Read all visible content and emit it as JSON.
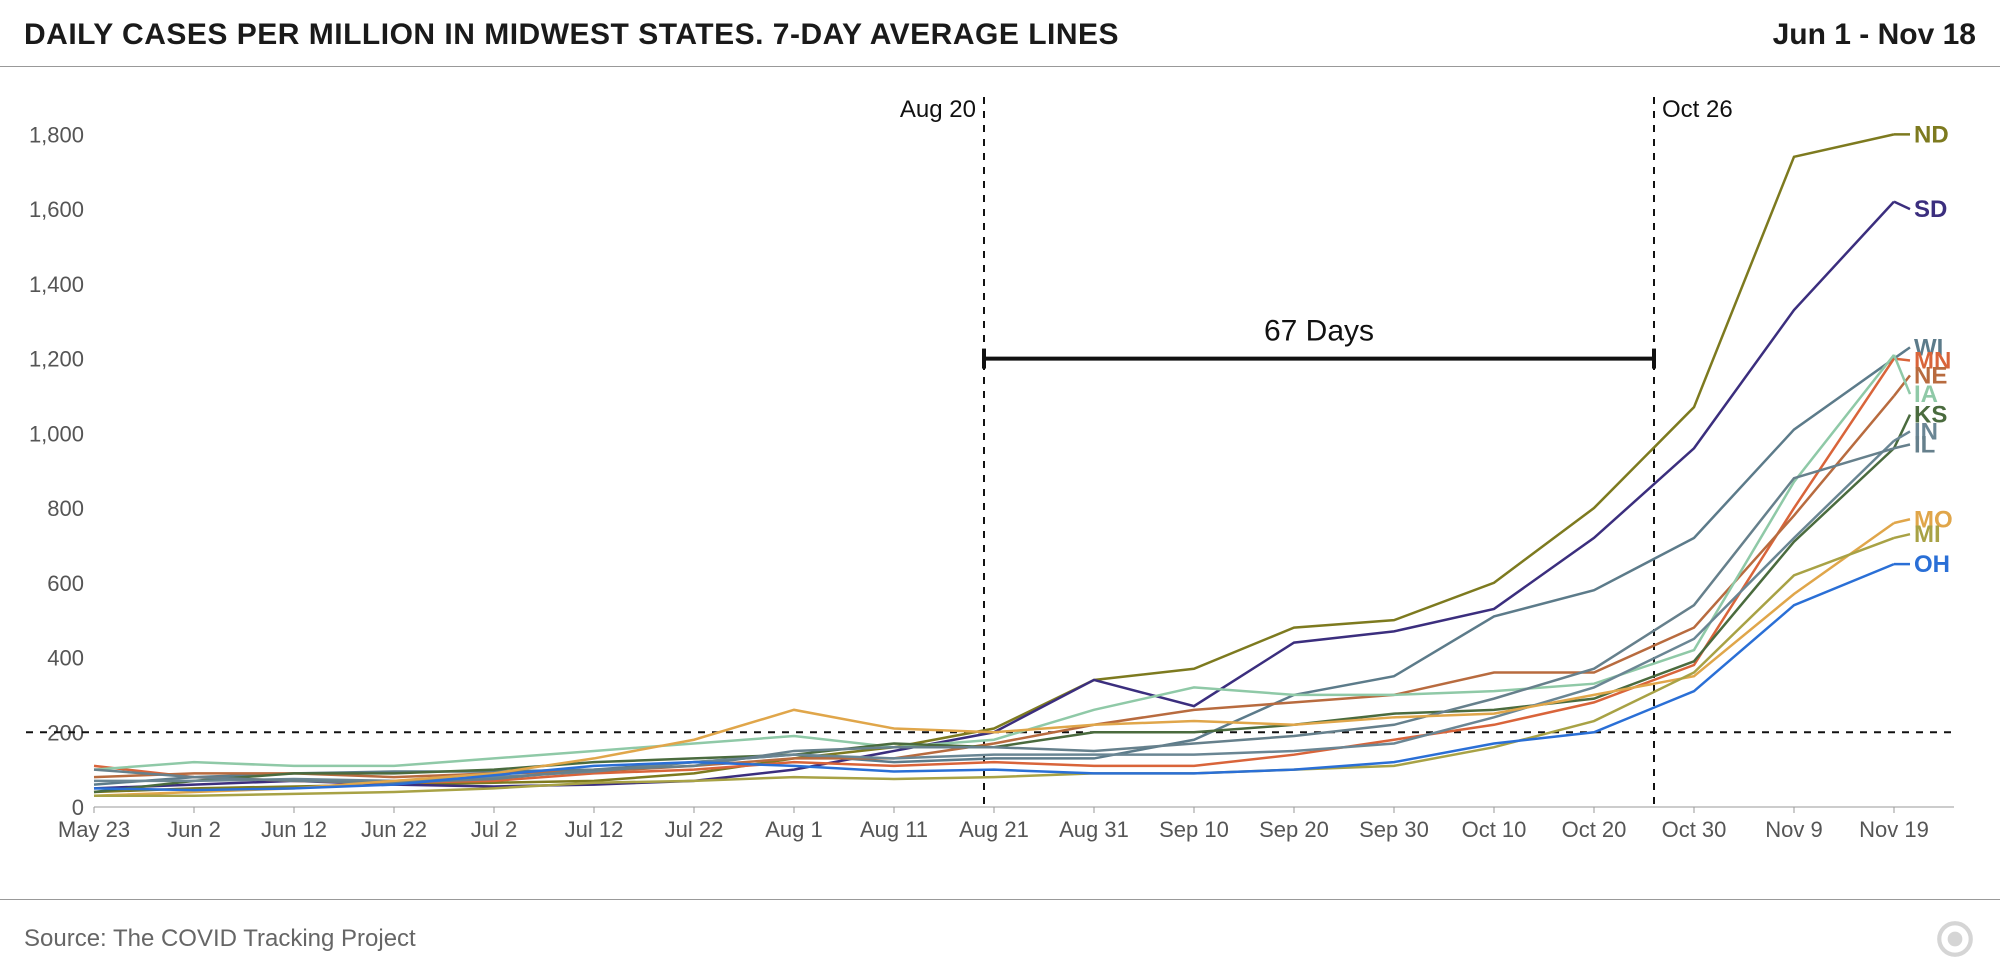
{
  "title": "DAILY CASES PER MILLION IN MIDWEST STATES. 7-DAY AVERAGE LINES",
  "date_range": "Jun 1 - Nov 18",
  "source": "Source: The COVID Tracking Project",
  "annotations": {
    "vline1_label": "Aug 20",
    "vline2_label": "Oct 26",
    "bracket_label": "67 Days",
    "hline_value": 200,
    "vline1_x": 89,
    "vline2_x": 156
  },
  "chart_data": {
    "type": "line",
    "title": "Daily cases per million in Midwest states. 7-day average lines",
    "xlabel": "",
    "ylabel": "",
    "ylim": [
      0,
      1900
    ],
    "x_categories": [
      "May 23",
      "Jun 2",
      "Jun 12",
      "Jun 22",
      "Jul 2",
      "Jul 12",
      "Jul 22",
      "Aug 1",
      "Aug 11",
      "Aug 21",
      "Aug 31",
      "Sep 10",
      "Sep 20",
      "Sep 30",
      "Oct 10",
      "Oct 20",
      "Oct 30",
      "Nov 9",
      "Nov 19"
    ],
    "y_ticks": [
      0,
      200,
      400,
      600,
      800,
      1000,
      1200,
      1400,
      1600,
      1800
    ],
    "x": [
      0,
      10,
      20,
      30,
      40,
      50,
      60,
      70,
      80,
      90,
      100,
      110,
      120,
      130,
      140,
      150,
      160,
      170,
      180
    ],
    "series": [
      {
        "name": "ND",
        "color": "#7d7a1f",
        "label_y": 1800,
        "values": [
          40,
          50,
          55,
          60,
          65,
          70,
          90,
          130,
          160,
          210,
          340,
          370,
          480,
          500,
          600,
          800,
          1070,
          1740,
          1800
        ]
      },
      {
        "name": "SD",
        "color": "#3b2e7e",
        "label_y": 1600,
        "values": [
          50,
          60,
          70,
          60,
          55,
          60,
          70,
          100,
          150,
          200,
          340,
          270,
          440,
          470,
          530,
          720,
          960,
          1330,
          1620
        ]
      },
      {
        "name": "WI",
        "color": "#5c7b8a",
        "label_y": 1230,
        "values": [
          60,
          80,
          90,
          95,
          95,
          100,
          120,
          140,
          120,
          130,
          130,
          180,
          300,
          350,
          510,
          580,
          720,
          1010,
          1200
        ]
      },
      {
        "name": "MN",
        "color": "#d9643a",
        "label_y": 1195,
        "values": [
          110,
          80,
          70,
          65,
          70,
          90,
          100,
          120,
          110,
          120,
          110,
          110,
          140,
          180,
          220,
          280,
          380,
          800,
          1200
        ]
      },
      {
        "name": "NE",
        "color": "#b86b3f",
        "label_y": 1155,
        "values": [
          80,
          90,
          90,
          80,
          90,
          95,
          110,
          130,
          130,
          170,
          220,
          260,
          280,
          300,
          360,
          360,
          480,
          780,
          1100
        ]
      },
      {
        "name": "IA",
        "color": "#8fc9a7",
        "label_y": 1105,
        "values": [
          100,
          120,
          110,
          110,
          130,
          150,
          170,
          190,
          160,
          180,
          260,
          320,
          300,
          300,
          310,
          330,
          420,
          870,
          1210
        ]
      },
      {
        "name": "KS",
        "color": "#4a6b3e",
        "label_y": 1050,
        "values": [
          40,
          70,
          90,
          90,
          100,
          120,
          130,
          140,
          170,
          160,
          200,
          200,
          220,
          250,
          260,
          290,
          390,
          710,
          960
        ]
      },
      {
        "name": "IN",
        "color": "#6a8694",
        "label_y": 1005,
        "values": [
          70,
          70,
          75,
          70,
          80,
          95,
          120,
          140,
          130,
          140,
          140,
          140,
          150,
          170,
          240,
          320,
          450,
          720,
          980
        ]
      },
      {
        "name": "IL",
        "color": "#66808c",
        "label_y": 970,
        "values": [
          100,
          80,
          70,
          65,
          75,
          100,
          110,
          150,
          160,
          160,
          150,
          170,
          190,
          220,
          290,
          370,
          540,
          880,
          960
        ]
      },
      {
        "name": "MO",
        "color": "#e0a64a",
        "label_y": 770,
        "values": [
          30,
          40,
          50,
          70,
          90,
          130,
          180,
          260,
          210,
          200,
          220,
          230,
          220,
          240,
          250,
          300,
          350,
          570,
          760
        ]
      },
      {
        "name": "MI",
        "color": "#a8a245",
        "label_y": 730,
        "values": [
          30,
          30,
          35,
          40,
          50,
          65,
          70,
          80,
          75,
          80,
          90,
          90,
          100,
          110,
          160,
          230,
          360,
          620,
          720
        ]
      },
      {
        "name": "OH",
        "color": "#2a6fd6",
        "label_y": 650,
        "values": [
          50,
          45,
          50,
          60,
          85,
          110,
          120,
          110,
          95,
          100,
          90,
          90,
          100,
          120,
          170,
          200,
          310,
          540,
          650
        ]
      }
    ]
  }
}
